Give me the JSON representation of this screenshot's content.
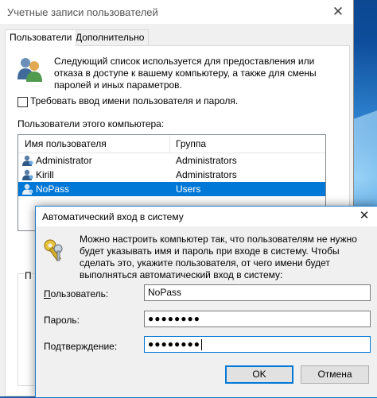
{
  "back_window": {
    "title": "Учетные записи пользователей",
    "close_glyph": "✕",
    "tabs": [
      {
        "label": "Пользователи"
      },
      {
        "label": "Дополнительно"
      }
    ],
    "description": "Следующий список используется для предоставления или отказа в доступе к вашему компьютеру, а также для смены паролей и иных параметров.",
    "require_login_label": "Требовать ввод имени пользователя и пароля.",
    "users_list_title": "Пользователи этого компьютера:",
    "columns": [
      "Имя пользователя",
      "Группа"
    ],
    "rows": [
      {
        "name": "Administrator",
        "group": "Administrators"
      },
      {
        "name": "Kirill",
        "group": "Administrators"
      },
      {
        "name": "NoPass",
        "group": "Users"
      }
    ],
    "groupbox_label_partial": "П"
  },
  "dialog": {
    "title": "Автоматический вход в систему",
    "close_glyph": "✕",
    "description": "Можно настроить компьютер так, что пользователям не нужно будет указывать имя и пароль при входе в систему. Чтобы сделать это, укажите пользователя, от чего имени будет выполняться автоматический вход в систему:",
    "user_label": "Пользователь:",
    "user_value": "NoPass",
    "password_label": "Пароль:",
    "password_value": "●●●●●●●●",
    "confirm_label": "Подтверждение:",
    "confirm_value": "●●●●●●●●",
    "ok_label": "OK",
    "cancel_label": "Отмена"
  },
  "colors": {
    "selection": "#0078d7",
    "accent": "#0078d7"
  },
  "icons": [
    "users-icon",
    "user-icon",
    "keys-icon",
    "close-icon"
  ]
}
